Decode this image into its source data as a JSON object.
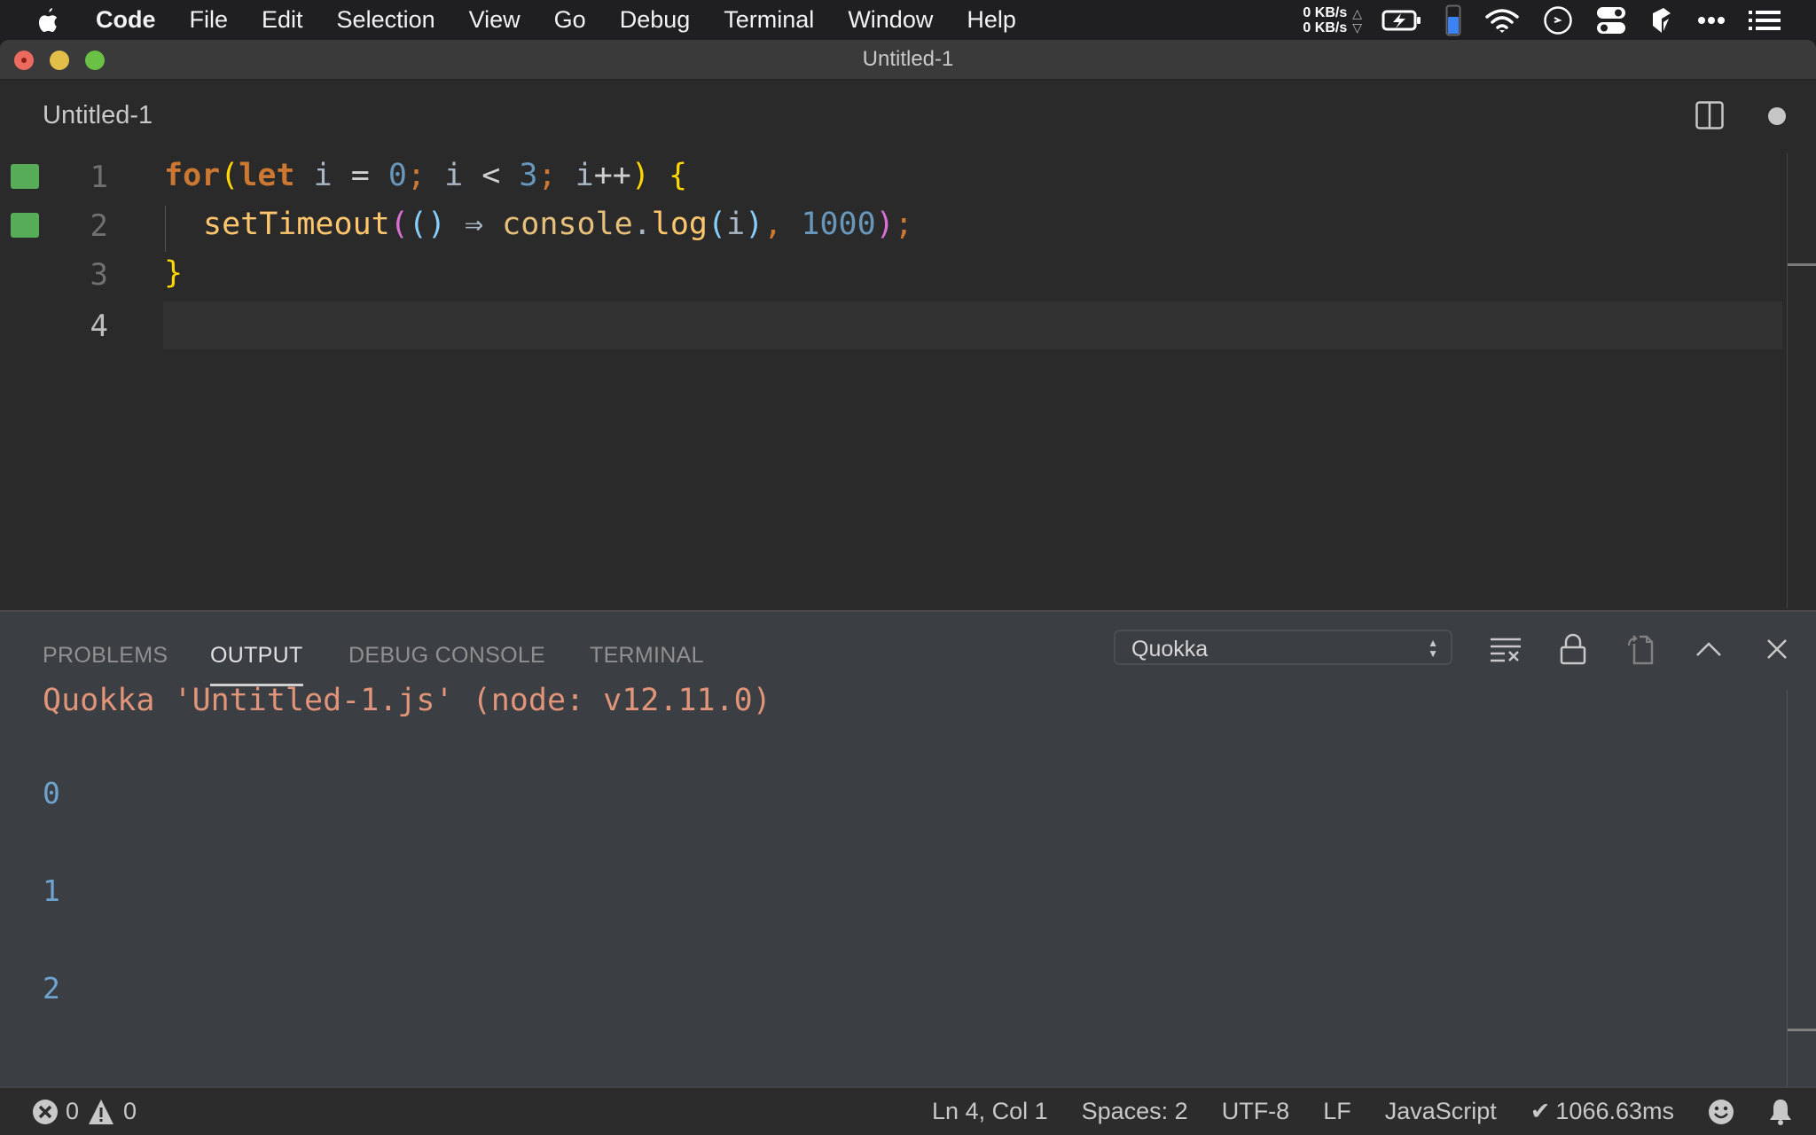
{
  "menubar": {
    "app_name": "Code",
    "items": [
      "File",
      "Edit",
      "Selection",
      "View",
      "Go",
      "Debug",
      "Terminal",
      "Window",
      "Help"
    ],
    "net_up": "0 KB/s",
    "net_down": "0 KB/s",
    "battery_level": 0.6
  },
  "window": {
    "title": "Untitled-1"
  },
  "editor": {
    "tab_title": "Untitled-1",
    "line_numbers": [
      "1",
      "2",
      "3",
      "4"
    ],
    "current_line": 4,
    "lines": [
      "for(let i = 0; i < 3; i++) {",
      "  setTimeout(() => console.log(i), 1000);",
      "}",
      ""
    ],
    "tokens": {
      "l1": {
        "for": "for",
        "p1": "(",
        "let": "let",
        "i1": " i ",
        "eq": "=",
        "n0": " 0",
        "s1": ";",
        "i2": " i ",
        "lt": "<",
        "n3": " 3",
        "s2": ";",
        "i3": " i",
        "inc": "++",
        "p2": ")",
        "br": " {"
      },
      "l2": {
        "fn": "setTimeout",
        "p1": "(",
        "p2": "(",
        "p3": ")",
        "arrow": " ⇒ ",
        "obj": "console",
        "dot": ".",
        "log": "log",
        "p4": "(",
        "i": "i",
        "p5": ")",
        "comma": ",",
        "n": " 1000",
        "p6": ")",
        "semi": ";"
      },
      "l3": {
        "br": "}"
      }
    }
  },
  "panel": {
    "tabs": [
      "PROBLEMS",
      "OUTPUT",
      "DEBUG CONSOLE",
      "TERMINAL"
    ],
    "active_tab": "OUTPUT",
    "channel": "Quokka",
    "output_header": "Quokka 'Untitled-1.js' (node: v12.11.0)",
    "output_lines": [
      "0",
      "1",
      "2"
    ]
  },
  "statusbar": {
    "errors": "0",
    "warnings": "0",
    "position": "Ln 4, Col 1",
    "spaces": "Spaces: 2",
    "encoding": "UTF-8",
    "eol": "LF",
    "language": "JavaScript",
    "timing": "1066.63ms"
  },
  "colors": {
    "gutter_green": "#57ad57",
    "keyword": "#cc7832",
    "number": "#6897bb",
    "function": "#ffc66d",
    "output_header": "#e0957a",
    "output_value": "#6fa3cf"
  }
}
